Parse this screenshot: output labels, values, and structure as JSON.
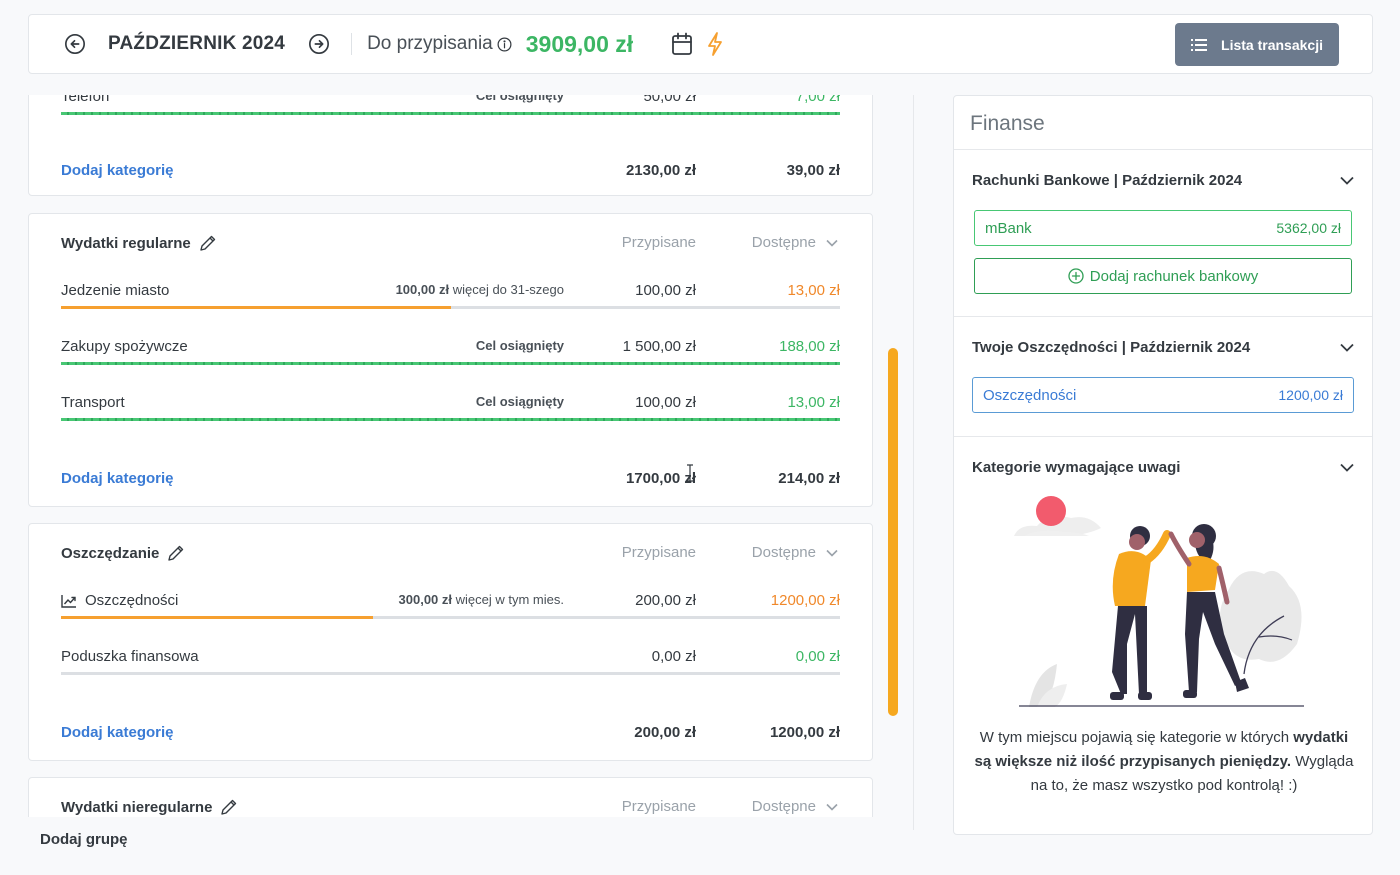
{
  "header": {
    "month": "PAŹDZIERNIK 2024",
    "assign_label": "Do przypisania",
    "assign_amount": "3909,00 zł",
    "transactions_button": "Lista transakcji"
  },
  "colors": {
    "green": "#3cb664",
    "orange": "#f0882a",
    "blue": "#3a7bd5",
    "accent_bar": "#f6a81f"
  },
  "groups": [
    {
      "title": "",
      "rows": [
        {
          "name": "Telefon",
          "note": "Cel osiągnięty",
          "assigned": "50,00 zł",
          "available": "7,00 zł",
          "progress": 1.0
        }
      ],
      "add_label": "Dodaj kategorię",
      "total_assigned": "2130,00 zł",
      "total_available": "39,00 zł"
    },
    {
      "title": "Wydatki regularne",
      "col_assigned": "Przypisane",
      "col_available": "Dostępne",
      "rows": [
        {
          "name": "Jedzenie miasto",
          "note_amount": "100,00 zł",
          "note_text": "więcej do 31-szego",
          "assigned": "100,00 zł",
          "available": "13,00 zł",
          "progress": 0.5
        },
        {
          "name": "Zakupy spożywcze",
          "note": "Cel osiągnięty",
          "assigned": "1 500,00 zł",
          "available": "188,00 zł",
          "progress": 1.0
        },
        {
          "name": "Transport",
          "note": "Cel osiągnięty",
          "assigned": "100,00 zł",
          "available": "13,00 zł",
          "progress": 1.0
        }
      ],
      "add_label": "Dodaj kategorię",
      "total_assigned": "1700,00 zł",
      "total_available": "214,00 zł"
    },
    {
      "title": "Oszczędzanie",
      "col_assigned": "Przypisane",
      "col_available": "Dostępne",
      "rows": [
        {
          "name": "Oszczędności",
          "icon": "trend-up-icon",
          "note_amount": "300,00 zł",
          "note_text": "więcej w tym mies.",
          "assigned": "200,00 zł",
          "available": "1200,00 zł",
          "progress": 0.4
        },
        {
          "name": "Poduszka finansowa",
          "assigned": "0,00 zł",
          "available": "0,00 zł",
          "progress": 0.0
        }
      ],
      "add_label": "Dodaj kategorię",
      "total_assigned": "200,00 zł",
      "total_available": "1200,00 zł"
    },
    {
      "title": "Wydatki nieregularne",
      "col_assigned": "Przypisane",
      "col_available": "Dostępne"
    }
  ],
  "add_group": "Dodaj grupę",
  "finance": {
    "title": "Finanse",
    "bank": {
      "title": "Rachunki Bankowe | Październik 2024",
      "accounts": [
        {
          "name": "mBank",
          "balance": "5362,00 zł"
        }
      ],
      "add_label": "Dodaj rachunek bankowy"
    },
    "savings": {
      "title": "Twoje Oszczędności | Październik 2024",
      "accounts": [
        {
          "name": "Oszczędności",
          "balance": "1200,00 zł"
        }
      ]
    },
    "attention": {
      "title": "Kategorie wymagające uwagi",
      "msg_1": "W tym miejscu pojawią się kategorie w których",
      "msg_bold": "wydatki są większe niż ilość przypisanych pieniędzy.",
      "msg_2": "Wygląda na to, że masz wszystko pod kontrolą! :)"
    }
  }
}
